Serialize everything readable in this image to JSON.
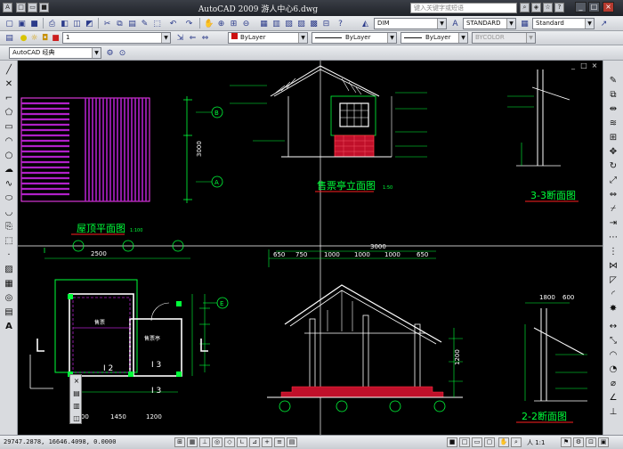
{
  "app": {
    "title": "AutoCAD 2009 游人中心6.dwg",
    "search_placeholder": "键入关键字或短语"
  },
  "toolbar": {
    "dim_style": "DIM",
    "text_style": "STANDARD",
    "table_style": "Standard",
    "layer": "1",
    "color": "ByLayer",
    "linetype": "ByLayer",
    "lineweight": "ByLayer",
    "plotstyle": "BYCOLOR",
    "workspace": "AutoCAD 经典"
  },
  "drawing": {
    "roof_plan_title": "屋顶平面图",
    "roof_plan_scale": "1:100",
    "ticket_elev_title": "售票亭立面图",
    "ticket_elev_scale": "1:50",
    "section33_title": "3-3断面图",
    "section22_title": "2-2断面图",
    "dim_3000": "3000",
    "dims_top": [
      "650",
      "750",
      "1000",
      "1000",
      "1000",
      "650"
    ],
    "dim_2500": "2500",
    "dim_1200a": "1200",
    "dim_1450": "1450",
    "dim_1200b": "1200",
    "dim_3000v": "3000",
    "dim_1800": "1800",
    "dim_600": "600",
    "dim_1200c": "1200",
    "grid_a": "A",
    "grid_b": "B",
    "grid_e": "E",
    "room_label": "售票",
    "room_label2": "售票亭",
    "lbl_i2": "I 2",
    "lbl_i3": "I 3",
    "lbl_i3b": "I 3"
  },
  "status": {
    "coords": "29747.2878, 16646.4098, 0.0000",
    "scale": "人 1:1"
  },
  "colors": {
    "canvas": "#000000",
    "roof_magenta": "#b020c8",
    "brick_red": "#c0102a",
    "cad_green": "#00ff3a",
    "cad_yellow": "#ffff00",
    "cad_white": "#ffffff"
  }
}
